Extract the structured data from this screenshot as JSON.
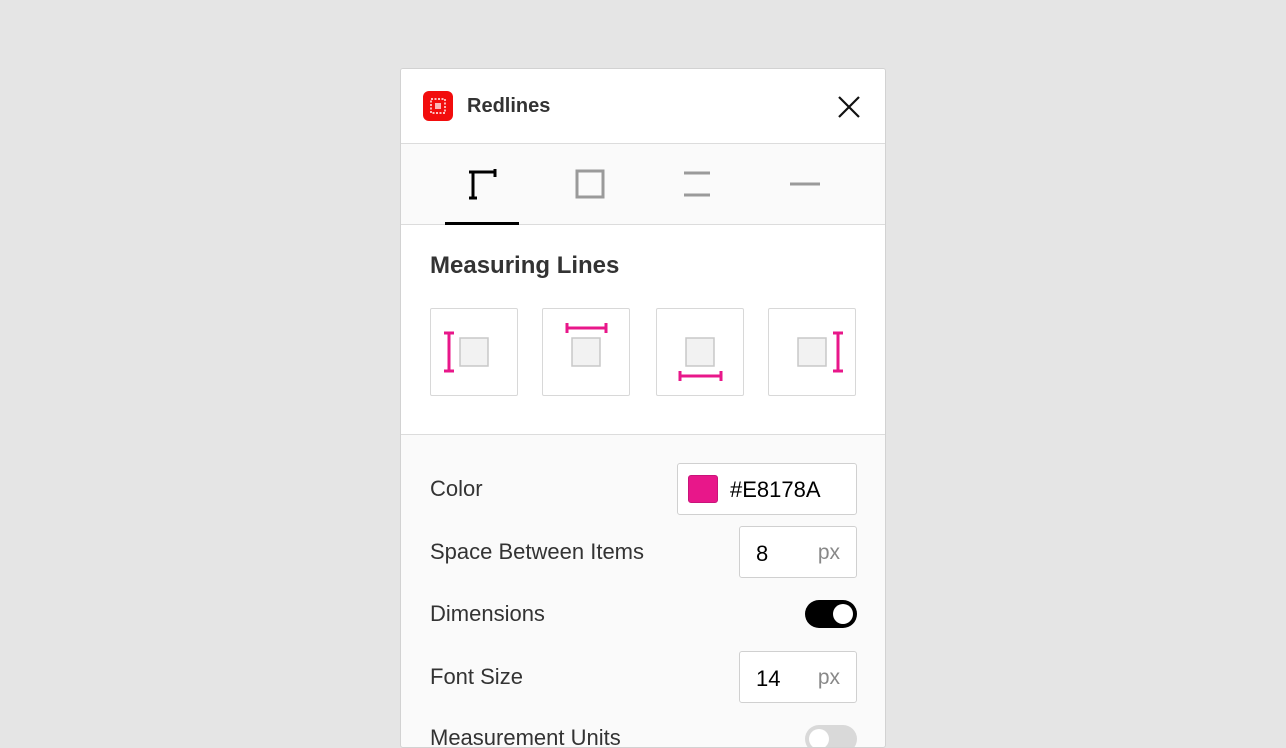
{
  "window": {
    "title": "Redlines"
  },
  "tabs": [
    {
      "name": "measuring-lines",
      "active": true
    },
    {
      "name": "frame",
      "active": false
    },
    {
      "name": "spacing",
      "active": false
    },
    {
      "name": "divider",
      "active": false
    }
  ],
  "measuring_lines": {
    "title": "Measuring Lines",
    "options": [
      "left",
      "top",
      "bottom",
      "right"
    ]
  },
  "settings": {
    "color": {
      "label": "Color",
      "value": "#E8178A"
    },
    "space_between": {
      "label": "Space Between Items",
      "value": "8",
      "unit": "px"
    },
    "dimensions": {
      "label": "Dimensions",
      "enabled": true
    },
    "font_size": {
      "label": "Font Size",
      "value": "14",
      "unit": "px"
    },
    "measurement_units": {
      "label": "Measurement Units",
      "enabled": false
    }
  },
  "colors": {
    "accent": "#E8178A",
    "app_icon": "#F20D0D",
    "toggle_on": "#000000",
    "toggle_off": "#D9D9D9"
  }
}
